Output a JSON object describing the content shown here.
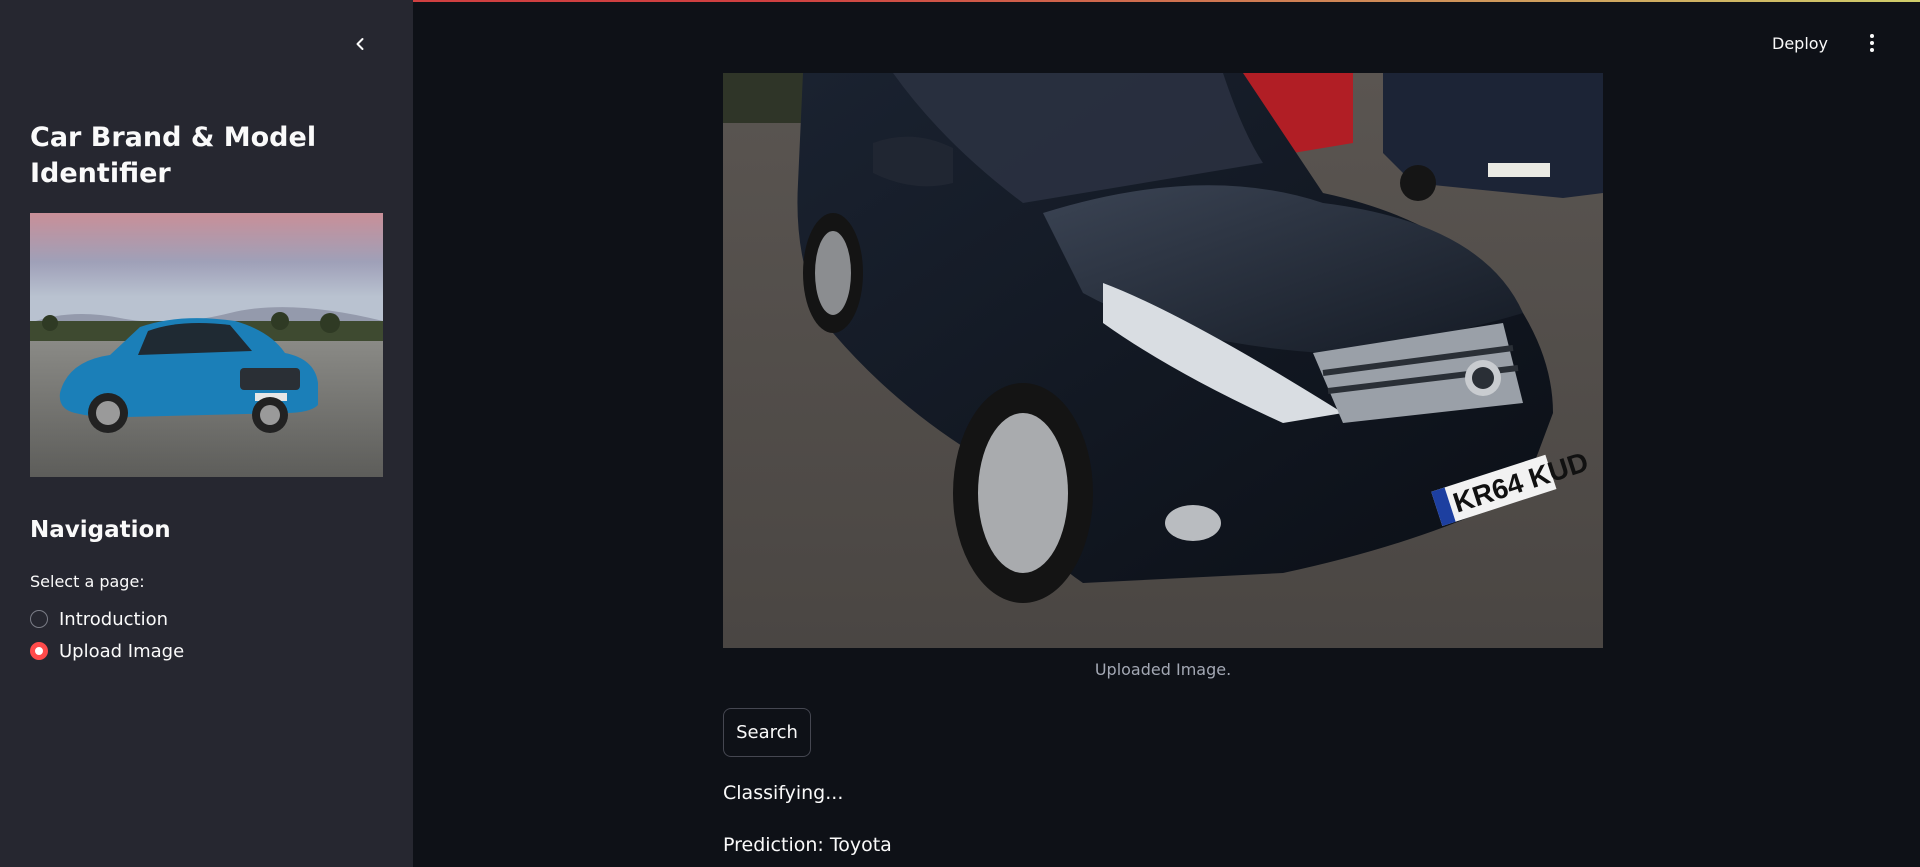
{
  "sidebar": {
    "title": "Car Brand & Model Identifier",
    "navigation_heading": "Navigation",
    "select_label": "Select a page:",
    "options": [
      {
        "label": "Introduction",
        "selected": false
      },
      {
        "label": "Upload Image",
        "selected": true
      }
    ],
    "collapse_icon": "chevron-left-icon"
  },
  "header": {
    "deploy_label": "Deploy",
    "menu_icon": "vertical-dots-icon"
  },
  "main": {
    "image_caption": "Uploaded Image.",
    "search_label": "Search",
    "status_text": "Classifying...",
    "prediction_text": "Prediction: Toyota"
  },
  "colors": {
    "background": "#0e1117",
    "sidebar": "#262730",
    "accent": "#ff4b4b",
    "text": "#fafafa",
    "caption": "#a3a8b4"
  }
}
